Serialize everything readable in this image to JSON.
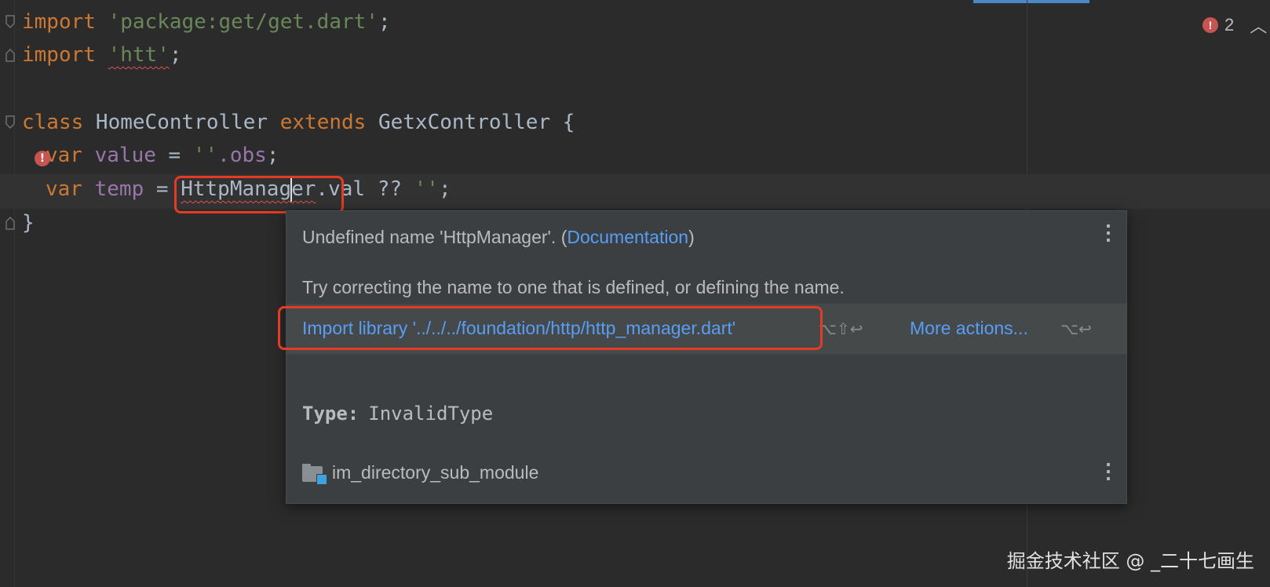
{
  "editor": {
    "lines": {
      "l1_kw": "import",
      "l1_str": " 'package:get/get.dart'",
      "l1_end": ";",
      "l2_kw": "import",
      "l2_sp": " ",
      "l2_str": "'htt'",
      "l2_end": ";",
      "l4_kw1": "class",
      "l4_name": " HomeController ",
      "l4_kw2": "extends",
      "l4_rest": " GetxController {",
      "l5_kw": "var",
      "l5_field": " value",
      "l5_eq": " = ",
      "l5_str": "''",
      "l5_obs": ".obs",
      "l5_end": ";",
      "l6_kw": "var",
      "l6_field": " temp",
      "l6_eq": " = ",
      "l6_err_a": "HttpManag",
      "l6_err_b": "er",
      "l6_rest": ".val ?? ",
      "l6_str": "''",
      "l6_end": ";",
      "l7": "}"
    },
    "warning_glyph": "!",
    "error_count": "2",
    "error_glyph": "!",
    "chevron": "⌃"
  },
  "popup": {
    "message_prefix": "Undefined name 'HttpManager'. (",
    "documentation_link": "Documentation",
    "message_suffix": ")",
    "hint": "Try correcting the name to one that is defined, or defining the name.",
    "import_action": "Import library '../../../foundation/http/http_manager.dart'",
    "import_shortcut": "⌥⇧↩",
    "more_actions": "More actions...",
    "more_shortcut": "⌥↩",
    "type_label": "Type:",
    "type_value": "InvalidType",
    "module_name": "im_directory_sub_module",
    "menu_glyph": "⋮"
  },
  "watermark": "掘金技术社区 @ _二十七画生",
  "colors": {
    "background": "#2b2b2b",
    "keyword": "#cc7832",
    "string": "#6a8759",
    "field": "#9876aa",
    "link": "#589df6",
    "highlight_box": "#e53a23",
    "error": "#c75450"
  }
}
